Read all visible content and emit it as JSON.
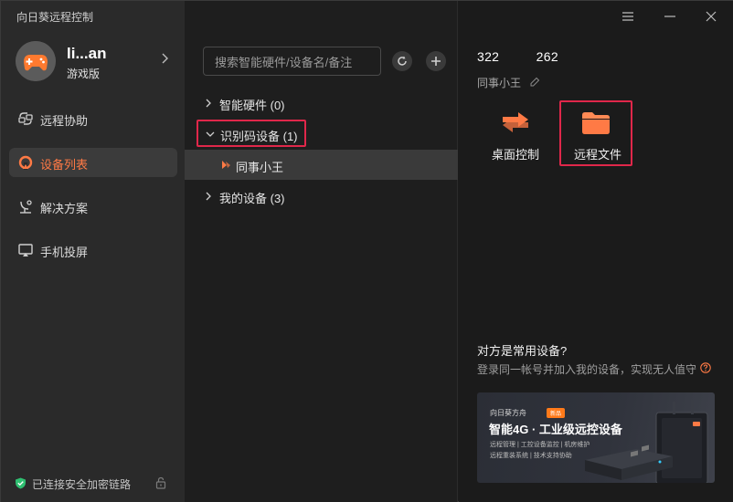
{
  "app": {
    "title": "向日葵远程控制"
  },
  "profile": {
    "username": "li...an",
    "edition": "游戏版"
  },
  "nav": [
    {
      "label": "远程协助",
      "icon": "remote-assist-icon",
      "active": false
    },
    {
      "label": "设备列表",
      "icon": "device-list-icon",
      "active": true
    },
    {
      "label": "解决方案",
      "icon": "solution-icon",
      "active": false
    },
    {
      "label": "手机投屏",
      "icon": "screen-mirror-icon",
      "active": false
    }
  ],
  "status": {
    "text": "已连接安全加密链路"
  },
  "search": {
    "placeholder": "搜索智能硬件/设备名/备注",
    "value": ""
  },
  "groups": {
    "smart_hardware": "智能硬件 (0)",
    "id_devices": "识别码设备 (1)",
    "my_devices": "我的设备 (3)"
  },
  "device_row": {
    "label": "同事小王"
  },
  "detail": {
    "id_prefix": "322",
    "id_suffix": "262",
    "name": "同事小王",
    "actions": [
      {
        "label": "桌面控制",
        "icon": "desktop-control-icon"
      },
      {
        "label": "远程文件",
        "icon": "remote-file-icon"
      }
    ],
    "tip_title": "对方是常用设备?",
    "tip_sub": "登录同一帐号并加入我的设备，实现无人值守"
  },
  "banner": {
    "brand": "向日葵方舟",
    "badge": "新品",
    "headline": "智能4G · 工业级远控设备",
    "lines": [
      "远程管理 | 工控设备监控 | 机房维护",
      "远程重装系统 | 技术支持协助"
    ]
  },
  "colors": {
    "accent": "#ff7a45",
    "highlight_box": "#e0274a",
    "sidebar_bg": "#2a2a2a",
    "panel_bg": "#1e1e1e"
  }
}
